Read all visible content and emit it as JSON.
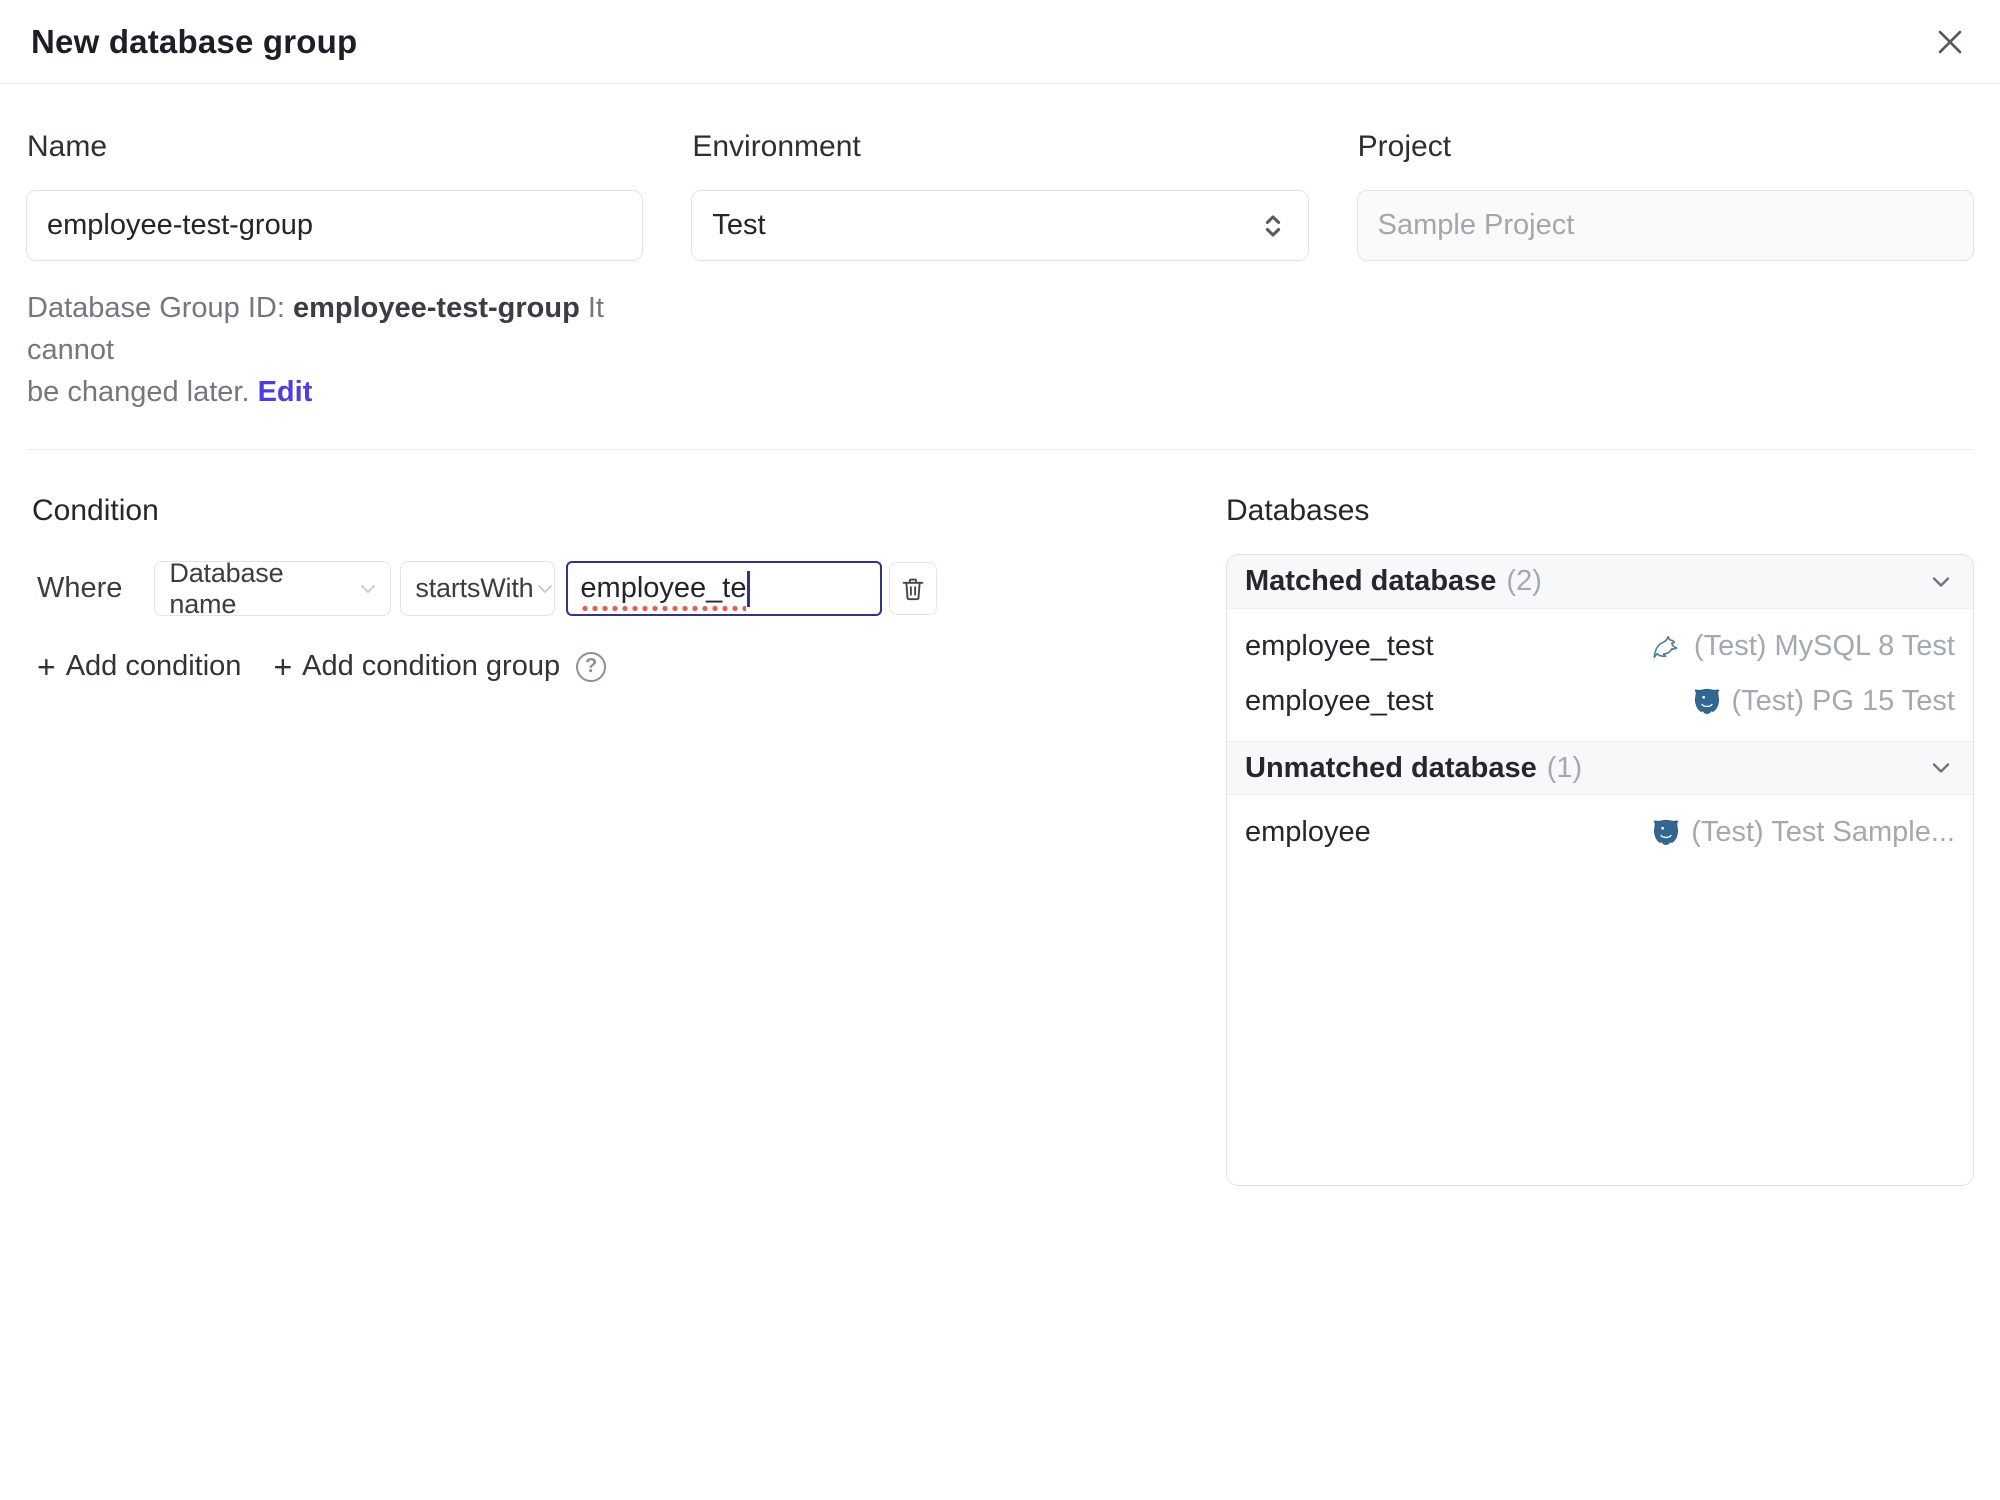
{
  "dialog": {
    "title": "New database group"
  },
  "form": {
    "name": {
      "label": "Name",
      "value": "employee-test-group"
    },
    "environment": {
      "label": "Environment",
      "value": "Test"
    },
    "project": {
      "label": "Project",
      "value": "Sample Project"
    },
    "group_id_help": {
      "prefix": "Database Group ID: ",
      "id": "employee-test-group",
      "line1_suffix": " It cannot",
      "line2_prefix": "be changed later. ",
      "edit_link": "Edit"
    }
  },
  "condition": {
    "heading": "Condition",
    "where_label": "Where",
    "field_select_value": "Database name",
    "operator_select_value": "startsWith",
    "value_input_value": "employee_te",
    "add_condition_label": "Add condition",
    "add_condition_group_label": "Add condition group"
  },
  "databases": {
    "heading": "Databases",
    "sections": [
      {
        "title": "Matched database",
        "count": "(2)",
        "rows": [
          {
            "name": "employee_test",
            "engine": "mysql",
            "instance": "(Test) MySQL 8 Test"
          },
          {
            "name": "employee_test",
            "engine": "postgresql",
            "instance": "(Test) PG 15 Test"
          }
        ]
      },
      {
        "title": "Unmatched database",
        "count": "(1)",
        "rows": [
          {
            "name": "employee",
            "engine": "postgresql",
            "instance": "(Test) Test Sample..."
          }
        ]
      }
    ]
  },
  "icons": {
    "plus": "+",
    "help": "?",
    "close_icon": "x-cross",
    "chevron_down_icon": "chevron-down",
    "select_stepper_icon": "up-down-chevrons",
    "trash_icon": "trash-can",
    "mysql_icon": "mysql-dolphin",
    "postgresql_icon": "postgres-elephant",
    "text_caret": "caret-bar"
  },
  "colors": {
    "accent_link": "#4b3fe0",
    "focused_border": "#373382",
    "spellcheck_red": "#e0604f",
    "border": "#e1e3e6",
    "section_header_bg": "#f7f8f9",
    "muted_text": "#a3a9b1",
    "mysql_blue": "#4e7a96",
    "postgres_blue": "#336791"
  }
}
